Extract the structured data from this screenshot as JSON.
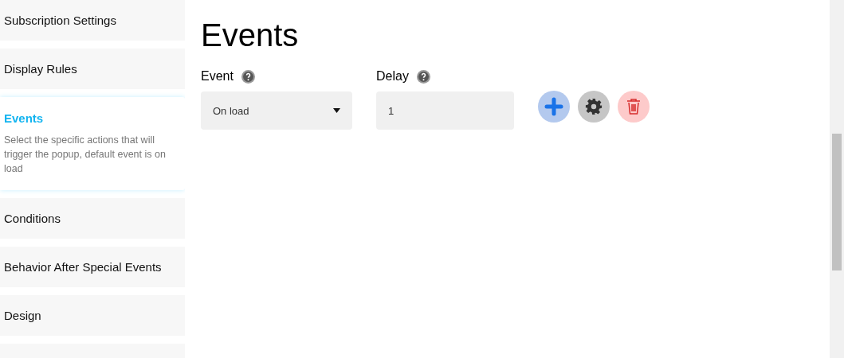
{
  "sidebar": {
    "items": [
      {
        "label": "Subscription Settings",
        "selected": false
      },
      {
        "label": "Display Rules",
        "selected": false
      },
      {
        "label": "Events",
        "selected": true,
        "description": "Select the specific actions that will trigger the popup, default event is on load"
      },
      {
        "label": "Conditions",
        "selected": false
      },
      {
        "label": "Behavior After Special Events",
        "selected": false
      },
      {
        "label": "Design",
        "selected": false
      }
    ]
  },
  "main": {
    "title": "Events",
    "fields": [
      {
        "kind": "select",
        "label": "Event",
        "value": "On load"
      },
      {
        "kind": "input",
        "label": "Delay",
        "value": "1"
      }
    ],
    "actions": [
      {
        "kind": "add"
      },
      {
        "kind": "settings"
      },
      {
        "kind": "delete"
      }
    ]
  }
}
